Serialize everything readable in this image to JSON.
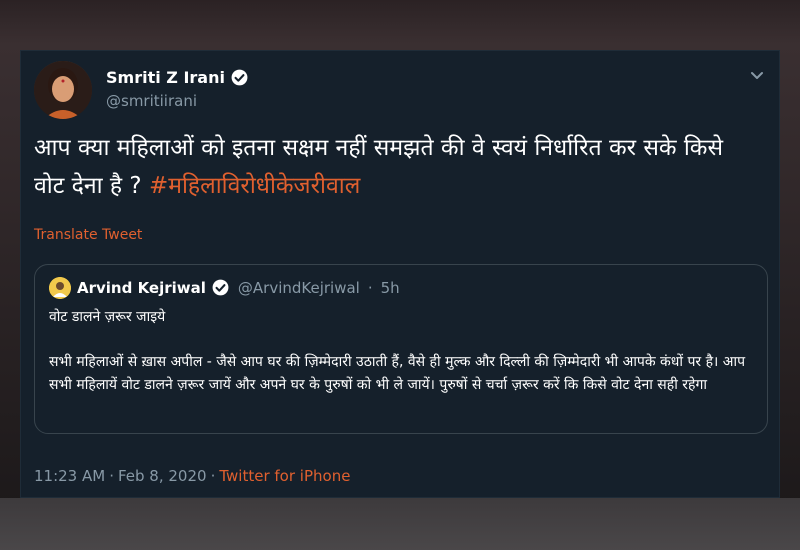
{
  "tweet": {
    "author_name": "Smriti Z Irani",
    "author_handle": "@smritiirani",
    "text": "आप क्या महिलाओं को इतना सक्षम नहीं समझते की वे स्वयं निर्धारित कर सके किसे वोट देना है ? ",
    "hashtag": "#महिलाविरोधीकेजरीवाल",
    "translate_label": "Translate Tweet",
    "time": "11:23 AM",
    "separator": "·",
    "date": "Feb 8, 2020",
    "source": "Twitter for iPhone"
  },
  "quoted": {
    "author_name": "Arvind Kejriwal",
    "author_handle": "@ArvindKejriwal",
    "separator": "·",
    "age": "5h",
    "short_text": "वोट डालने ज़रूर जाइये",
    "body_text": "सभी महिलाओं से ख़ास अपील - जैसे आप घर की ज़िम्मेदारी उठाती हैं, वैसे ही मुल्क और दिल्ली की ज़िम्मेदारी भी आपके कंधों पर है। आप सभी महिलायें वोट डालने ज़रूर जायें और अपने घर के पुरुषों को भी ले जायें। पुरुषों से चर्चा ज़रूर करें कि किसे वोट देना सही रहेगा"
  },
  "icons": {
    "verified": "verified-badge-icon",
    "menu": "chevron-down-icon"
  },
  "colors": {
    "background": "#15202b",
    "accent": "#e0602f",
    "muted": "#8899a6",
    "border": "#38444d"
  }
}
